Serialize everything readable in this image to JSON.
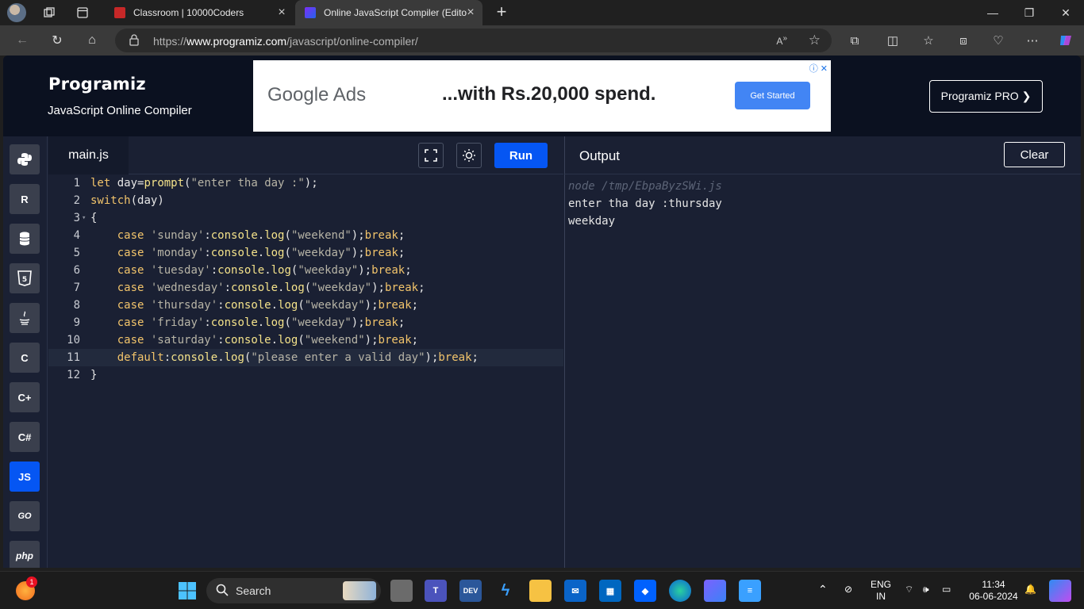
{
  "browser": {
    "tabs": [
      {
        "title": "Classroom | 10000Coders",
        "active": false
      },
      {
        "title": "Online JavaScript Compiler (Edito",
        "active": true
      }
    ],
    "url_prefix": "https://",
    "url_domain": "www.programiz.com",
    "url_path": "/javascript/online-compiler/"
  },
  "header": {
    "logo": "Programiz",
    "subtitle": "JavaScript Online Compiler",
    "pro_button": "Programiz PRO ❯"
  },
  "ad": {
    "brand": "Google Ads",
    "headline": "...with Rs.20,000 spend.",
    "cta": "Get Started"
  },
  "languages": [
    {
      "name": "python-icon",
      "label": ""
    },
    {
      "name": "r-icon",
      "label": "R"
    },
    {
      "name": "sql-icon",
      "label": ""
    },
    {
      "name": "html-icon",
      "label": "5"
    },
    {
      "name": "java-icon",
      "label": ""
    },
    {
      "name": "c-icon",
      "label": "C"
    },
    {
      "name": "cpp-icon",
      "label": "C+"
    },
    {
      "name": "csharp-icon",
      "label": "C#"
    },
    {
      "name": "js-icon",
      "label": "JS"
    },
    {
      "name": "go-icon",
      "label": "GO"
    },
    {
      "name": "php-icon",
      "label": "php"
    }
  ],
  "editor": {
    "filename": "main.js",
    "run_label": "Run",
    "lines": [
      "let day=prompt(\"enter tha day :\");",
      "switch(day)",
      "{",
      "    case 'sunday':console.log(\"weekend\");break;",
      "    case 'monday':console.log(\"weekday\");break;",
      "    case 'tuesday':console.log(\"weekday\");break;",
      "    case 'wednesday':console.log(\"weekday\");break;",
      "    case 'thursday':console.log(\"weekday\");break;",
      "    case 'friday':console.log(\"weekday\");break;",
      "    case 'saturday':console.log(\"weekend\");break;",
      "    default:console.log(\"please enter a valid day\");break;",
      "}"
    ]
  },
  "output": {
    "title": "Output",
    "clear_label": "Clear",
    "lines": [
      "node /tmp/EbpaByzSWi.js",
      "enter tha day :thursday",
      "weekday"
    ]
  },
  "taskbar": {
    "search_label": "Search",
    "lang_line1": "ENG",
    "lang_line2": "IN",
    "time": "11:34",
    "date": "06-06-2024",
    "weather_badge": "1"
  },
  "colors": {
    "accent": "#0556f3",
    "page_bg": "#1a2033",
    "header_bg": "#0b1120"
  }
}
